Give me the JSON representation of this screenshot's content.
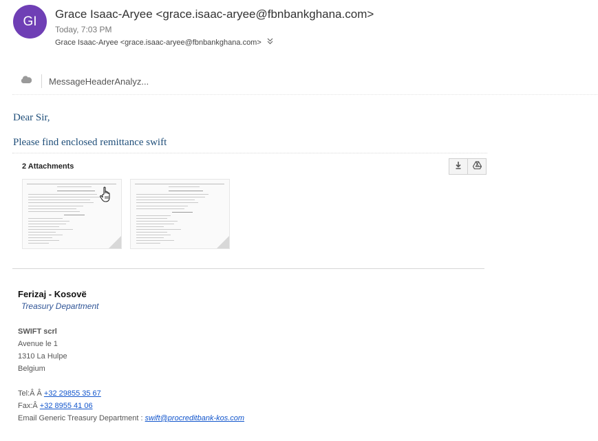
{
  "header": {
    "avatar_initials": "GI",
    "avatar_color": "#6f3fb5",
    "sender": "Grace Isaac-Aryee <grace.isaac-aryee@fbnbankghana.com>",
    "timestamp": "Today, 7:03 PM",
    "recipient": "Grace Isaac-Aryee <grace.isaac-aryee@fbnbankghana.com>",
    "expand_icon": "double-chevron-down-icon"
  },
  "addin": {
    "icon": "cloud-icon",
    "label": "MessageHeaderAnalyz..."
  },
  "body": {
    "greeting": "Dear Sir,",
    "line": "Please find enclosed remittance swift"
  },
  "attachments": {
    "title": "2 Attachments",
    "download_icon": "download-icon",
    "drive_icon": "drive-icon"
  },
  "signature": {
    "name": "Ferizaj - Kosovë",
    "department": "Treasury Department",
    "company": "SWIFT scrl",
    "address1": "Avenue le 1",
    "address2": "1310 La Hulpe",
    "country": "Belgium",
    "tel_label": "Tel:Â Â ",
    "tel": "+32 29855 35 67",
    "fax_label": "Fax:Â ",
    "fax": "+32 8955 41 06",
    "email_label": "Email Generic Treasury Department : ",
    "email": "swift@procreditbank-kos.com"
  }
}
